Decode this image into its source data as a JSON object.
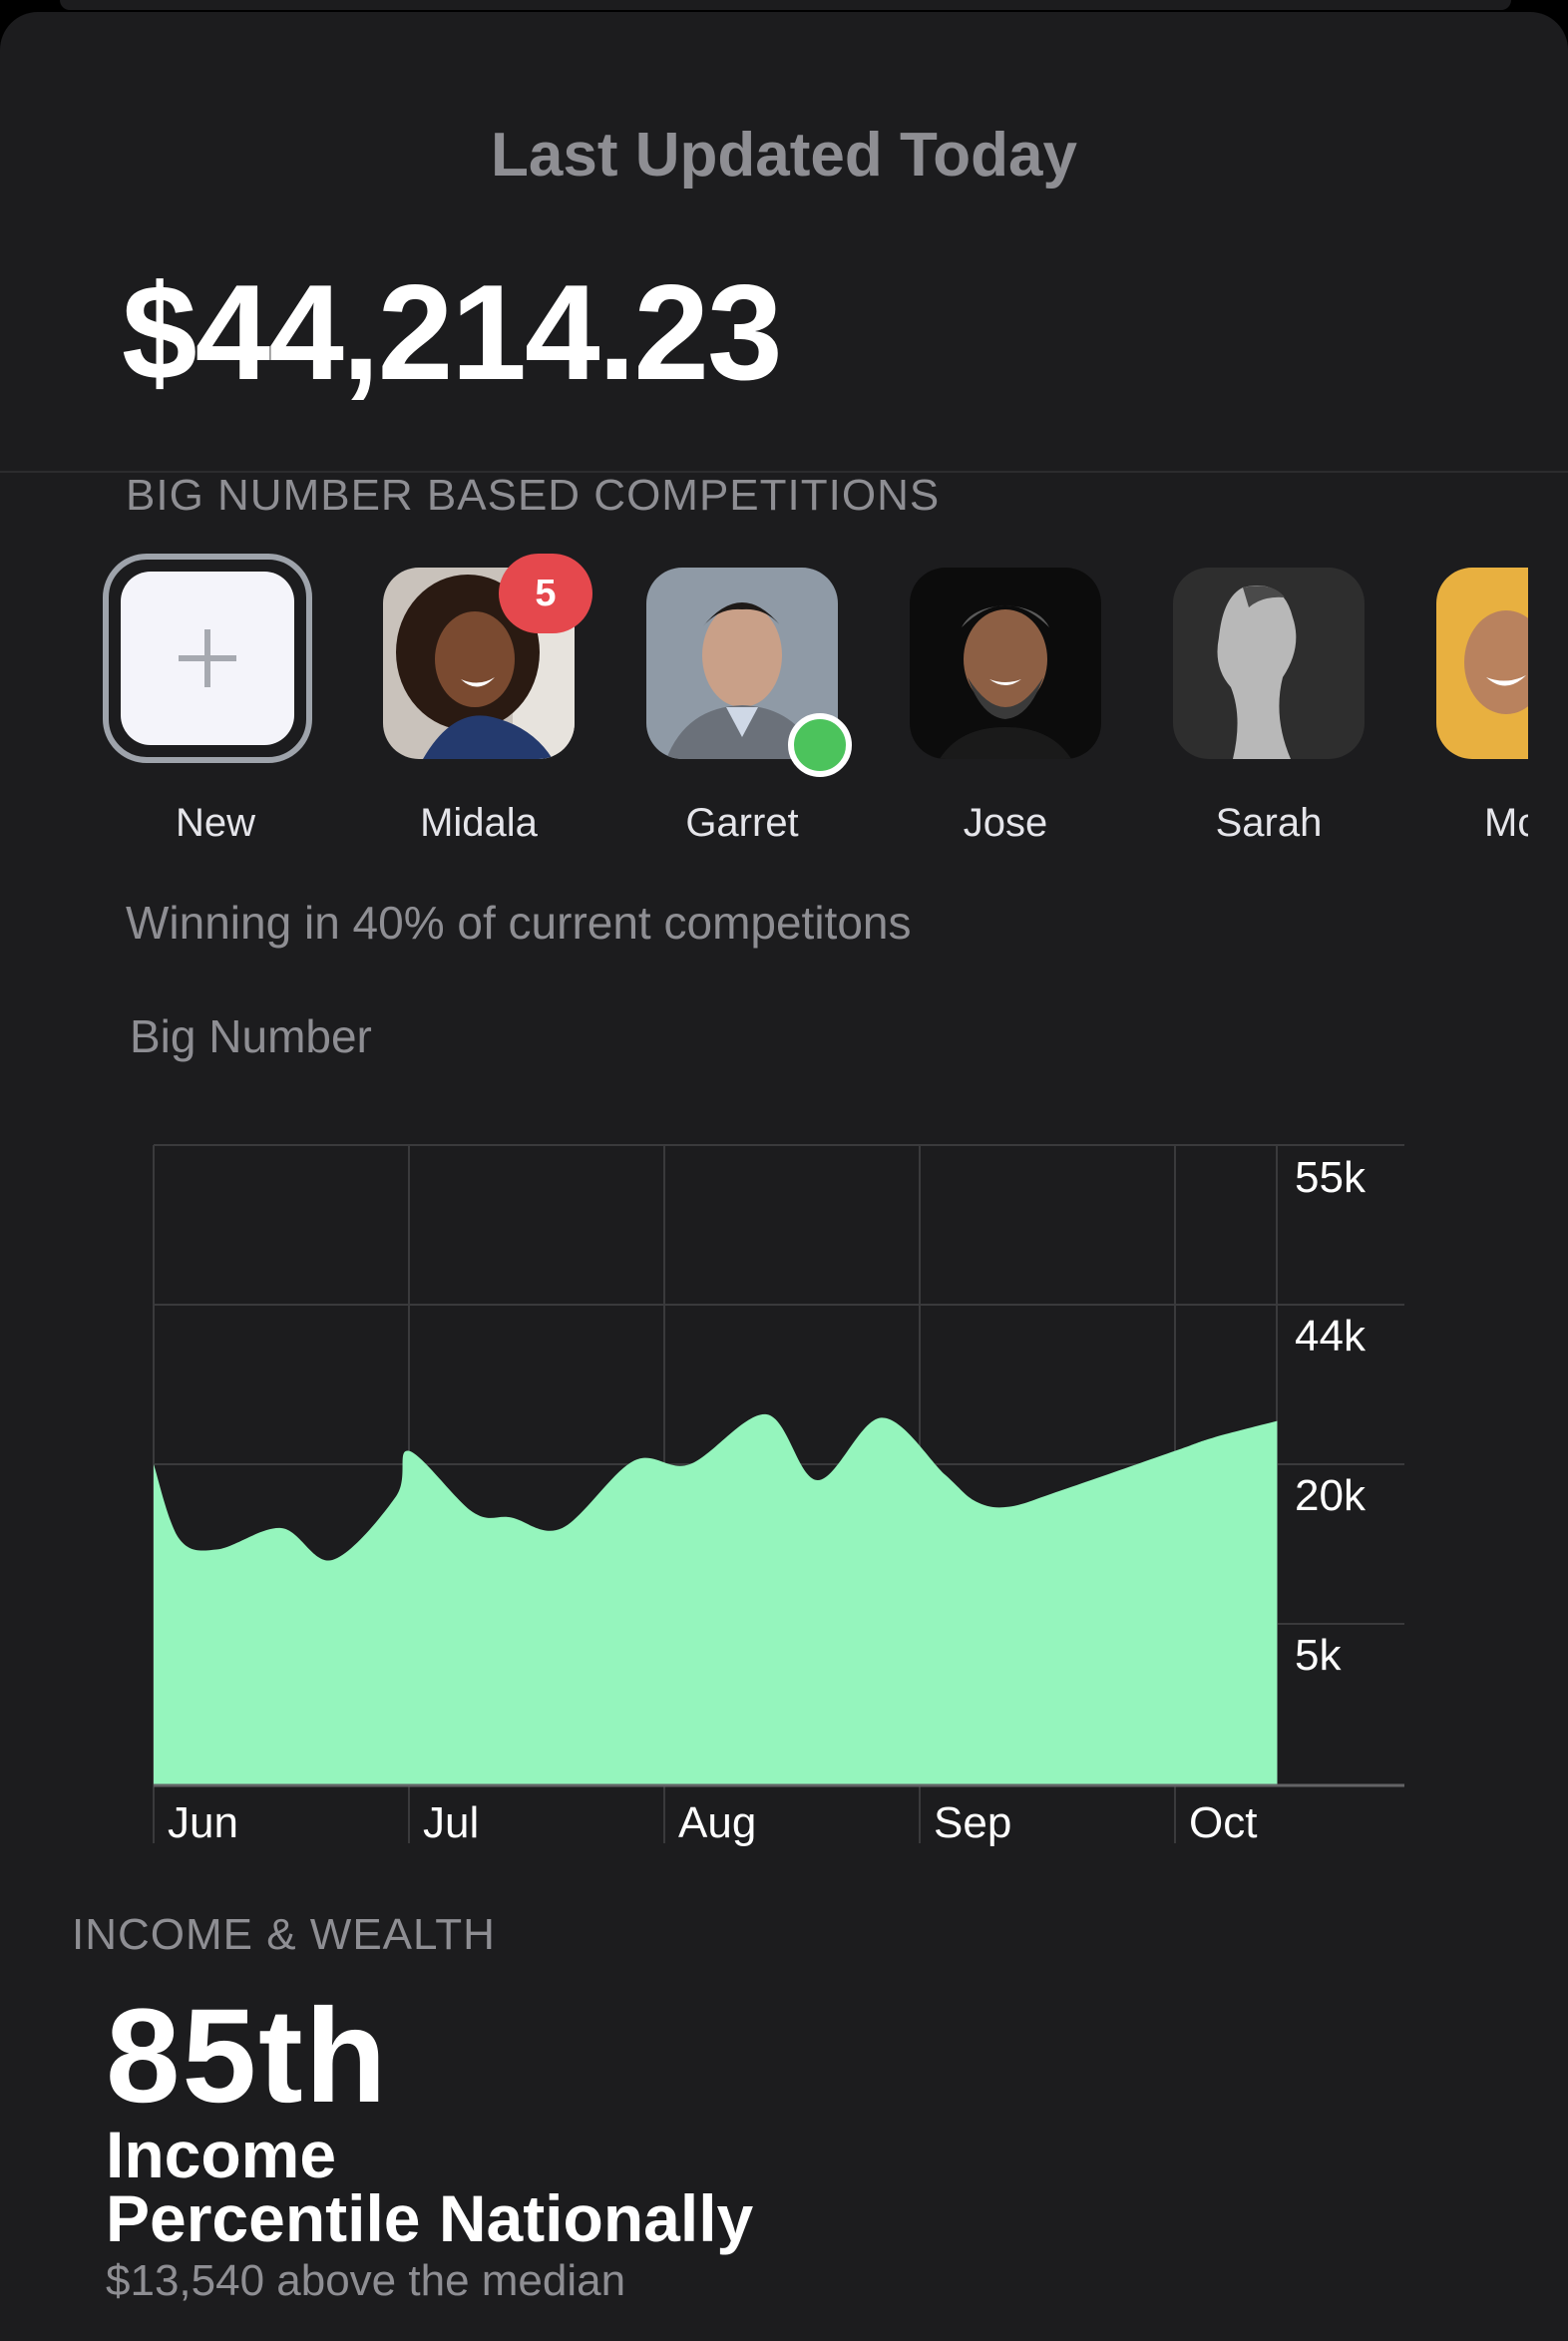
{
  "header": {
    "status": "Last Updated Today",
    "balance": "$44,214.23"
  },
  "competitions": {
    "section_label": "BIG NUMBER BASED COMPETITIONS",
    "new_label": "New",
    "people": [
      {
        "name": "Midala",
        "badge": "5"
      },
      {
        "name": "Garret",
        "online": true
      },
      {
        "name": "Jose"
      },
      {
        "name": "Sarah"
      },
      {
        "name": "Mc"
      }
    ],
    "winning_text": "Winning in 40% of current competitons"
  },
  "chart_title": "Big Number",
  "chart_data": {
    "type": "area",
    "x_months": [
      "Jun",
      "Jul",
      "Aug",
      "Sep",
      "Oct"
    ],
    "y_ticks": [
      "55k",
      "44k",
      "20k",
      "5k"
    ],
    "fill_color": "#95f5bd",
    "grid": true,
    "series": [
      {
        "x_month_index": [
          0.0,
          0.1,
          0.25,
          0.5,
          0.7,
          0.95,
          1.0,
          1.25,
          1.4,
          1.6,
          1.88,
          2.1,
          2.4,
          2.6,
          2.85,
          3.1,
          3.22,
          3.35,
          3.55,
          4.0,
          4.15,
          4.4
        ],
        "values": [
          20000,
          13000,
          12000,
          14000,
          11000,
          17000,
          22000,
          15500,
          15000,
          14000,
          20500,
          20000,
          27500,
          18500,
          27000,
          19000,
          16500,
          16000,
          17500,
          22000,
          24000,
          26500
        ]
      }
    ]
  },
  "income": {
    "section_label": "INCOME & WEALTH",
    "percentile": "85th",
    "line1": "Income",
    "line2": "Percentile Nationally",
    "subtext": "$13,540 above the median"
  },
  "colors": {
    "background": "#1c1c1e",
    "muted_text": "#8e8e93",
    "chart_fill": "#95f5bd",
    "badge": "#e5484d",
    "online": "#4cc35c"
  }
}
